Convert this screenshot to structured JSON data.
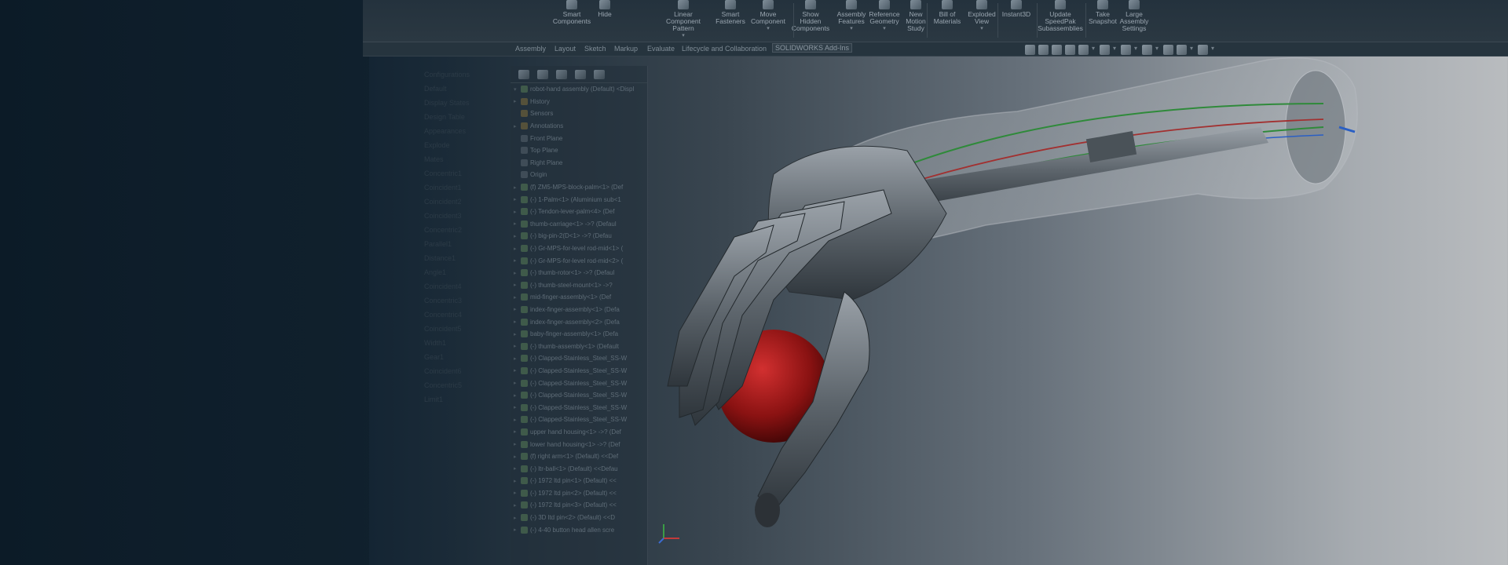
{
  "ribbon": {
    "buttons": [
      {
        "label": "Smart\nComponents",
        "caret": false
      },
      {
        "label": "Hide",
        "caret": false
      },
      {
        "label": "Linear Component\nPattern",
        "caret": true
      },
      {
        "label": "Smart\nFasteners",
        "caret": false
      },
      {
        "label": "Move\nComponent",
        "caret": true
      },
      {
        "label": "Show\nHidden\nComponents",
        "caret": false
      },
      {
        "label": "Assembly\nFeatures",
        "caret": true
      },
      {
        "label": "Reference\nGeometry",
        "caret": true
      },
      {
        "label": "New\nMotion\nStudy",
        "caret": false
      },
      {
        "label": "Bill of\nMaterials",
        "caret": false
      },
      {
        "label": "Exploded\nView",
        "caret": true
      },
      {
        "label": "Instant3D",
        "caret": false
      },
      {
        "label": "Update\nSpeedPak\nSubassemblies",
        "caret": false
      },
      {
        "label": "Take\nSnapshot",
        "caret": false
      },
      {
        "label": "Large\nAssembly\nSettings",
        "caret": false
      }
    ]
  },
  "tabs": [
    "Assembly",
    "Layout",
    "Sketch",
    "Markup",
    "Evaluate",
    "Lifecycle and Collaboration",
    "SOLIDWORKS Add-Ins"
  ],
  "active_tab": 6,
  "feature_tree": {
    "rows": [
      {
        "label": "robot-hand assembly (Default) <Displ",
        "icon": "assembly",
        "expand": "▾"
      },
      {
        "label": "History",
        "icon": "folder",
        "expand": "▸"
      },
      {
        "label": "Sensors",
        "icon": "folder",
        "expand": ""
      },
      {
        "label": "Annotations",
        "icon": "folder",
        "expand": "▸"
      },
      {
        "label": "Front Plane",
        "icon": "plane",
        "expand": ""
      },
      {
        "label": "Top Plane",
        "icon": "plane",
        "expand": ""
      },
      {
        "label": "Right Plane",
        "icon": "plane",
        "expand": ""
      },
      {
        "label": "Origin",
        "icon": "plane",
        "expand": ""
      },
      {
        "label": "(f) ZM5-MPS-block-palm<1> (Def",
        "icon": "part",
        "expand": "▸"
      },
      {
        "label": "(-) 1-Palm<1> (Aluminium sub<1",
        "icon": "part",
        "expand": "▸"
      },
      {
        "label": "(-) Tendon-lever-palm<4> (Def",
        "icon": "part",
        "expand": "▸"
      },
      {
        "label": "thumb-carriage<1> ->? (Defaul",
        "icon": "part",
        "expand": "▸"
      },
      {
        "label": "(-) big-pin-2(D<1> ->? (Defau",
        "icon": "part",
        "expand": "▸"
      },
      {
        "label": "(-) Gr-MPS-for-level rod-mid<1> (",
        "icon": "part",
        "expand": "▸"
      },
      {
        "label": "(-) Gr-MPS-for-level rod-mid<2> (",
        "icon": "part",
        "expand": "▸"
      },
      {
        "label": "(-) thumb-rotor<1> ->? (Defaul",
        "icon": "part",
        "expand": "▸"
      },
      {
        "label": "(-) thumb-steel-mount<1> ->?",
        "icon": "part",
        "expand": "▸"
      },
      {
        "label": "mid-finger-assembly<1> (Def",
        "icon": "part",
        "expand": "▸"
      },
      {
        "label": "index-finger-assembly<1> (Defa",
        "icon": "part",
        "expand": "▸"
      },
      {
        "label": "index-finger-assembly<2> (Defa",
        "icon": "part",
        "expand": "▸"
      },
      {
        "label": "baby-finger-assembly<1> (Defa",
        "icon": "part",
        "expand": "▸"
      },
      {
        "label": "(-) thumb-assembly<1> (Default",
        "icon": "part",
        "expand": "▸"
      },
      {
        "label": "(-) Clapped-Stainless_Steel_SS-W",
        "icon": "part",
        "expand": "▸"
      },
      {
        "label": "(-) Clapped-Stainless_Steel_SS-W",
        "icon": "part",
        "expand": "▸"
      },
      {
        "label": "(-) Clapped-Stainless_Steel_SS-W",
        "icon": "part",
        "expand": "▸"
      },
      {
        "label": "(-) Clapped-Stainless_Steel_SS-W",
        "icon": "part",
        "expand": "▸"
      },
      {
        "label": "(-) Clapped-Stainless_Steel_SS-W",
        "icon": "part",
        "expand": "▸"
      },
      {
        "label": "(-) Clapped-Stainless_Steel_SS-W",
        "icon": "part",
        "expand": "▸"
      },
      {
        "label": "upper hand housing<1> ->? (Def",
        "icon": "part",
        "expand": "▸"
      },
      {
        "label": "lower hand housing<1> ->? (Def",
        "icon": "part",
        "expand": "▸"
      },
      {
        "label": "(f) right arm<1> (Default) <<Def",
        "icon": "part",
        "expand": "▸"
      },
      {
        "label": "(-) ltr-ball<1> (Default) <<Defau",
        "icon": "part",
        "expand": "▸"
      },
      {
        "label": "(-) 1972 ltd pin<1> (Default) <<",
        "icon": "part",
        "expand": "▸"
      },
      {
        "label": "(-) 1972 ltd pin<2> (Default) <<",
        "icon": "part",
        "expand": "▸"
      },
      {
        "label": "(-) 1972 ltd pin<3> (Default) <<",
        "icon": "part",
        "expand": "▸"
      },
      {
        "label": "(-) 3D ltd pin<2> (Default) <<D",
        "icon": "part",
        "expand": "▸"
      },
      {
        "label": "(-) 4-40 button head allen scre",
        "icon": "part",
        "expand": "▸"
      }
    ]
  },
  "dim_tree": {
    "rows": [
      "Configurations",
      "Default",
      "Display States",
      "Design Table",
      "Appearances",
      "Explode",
      "Mates",
      "Concentric1",
      "Coincident1",
      "Coincident2",
      "Coincident3",
      "Concentric2",
      "Parallel1",
      "Distance1",
      "Angle1",
      "Coincident4",
      "Concentric3",
      "Concentric4",
      "Coincident5",
      "Width1",
      "Gear1",
      "Coincident6",
      "Concentric5",
      "Limit1"
    ]
  },
  "colors": {
    "accent_red": "#b31414",
    "wire_green": "#2f8a3a",
    "wire_red": "#a23030",
    "wire_blue": "#2a5fc4"
  }
}
